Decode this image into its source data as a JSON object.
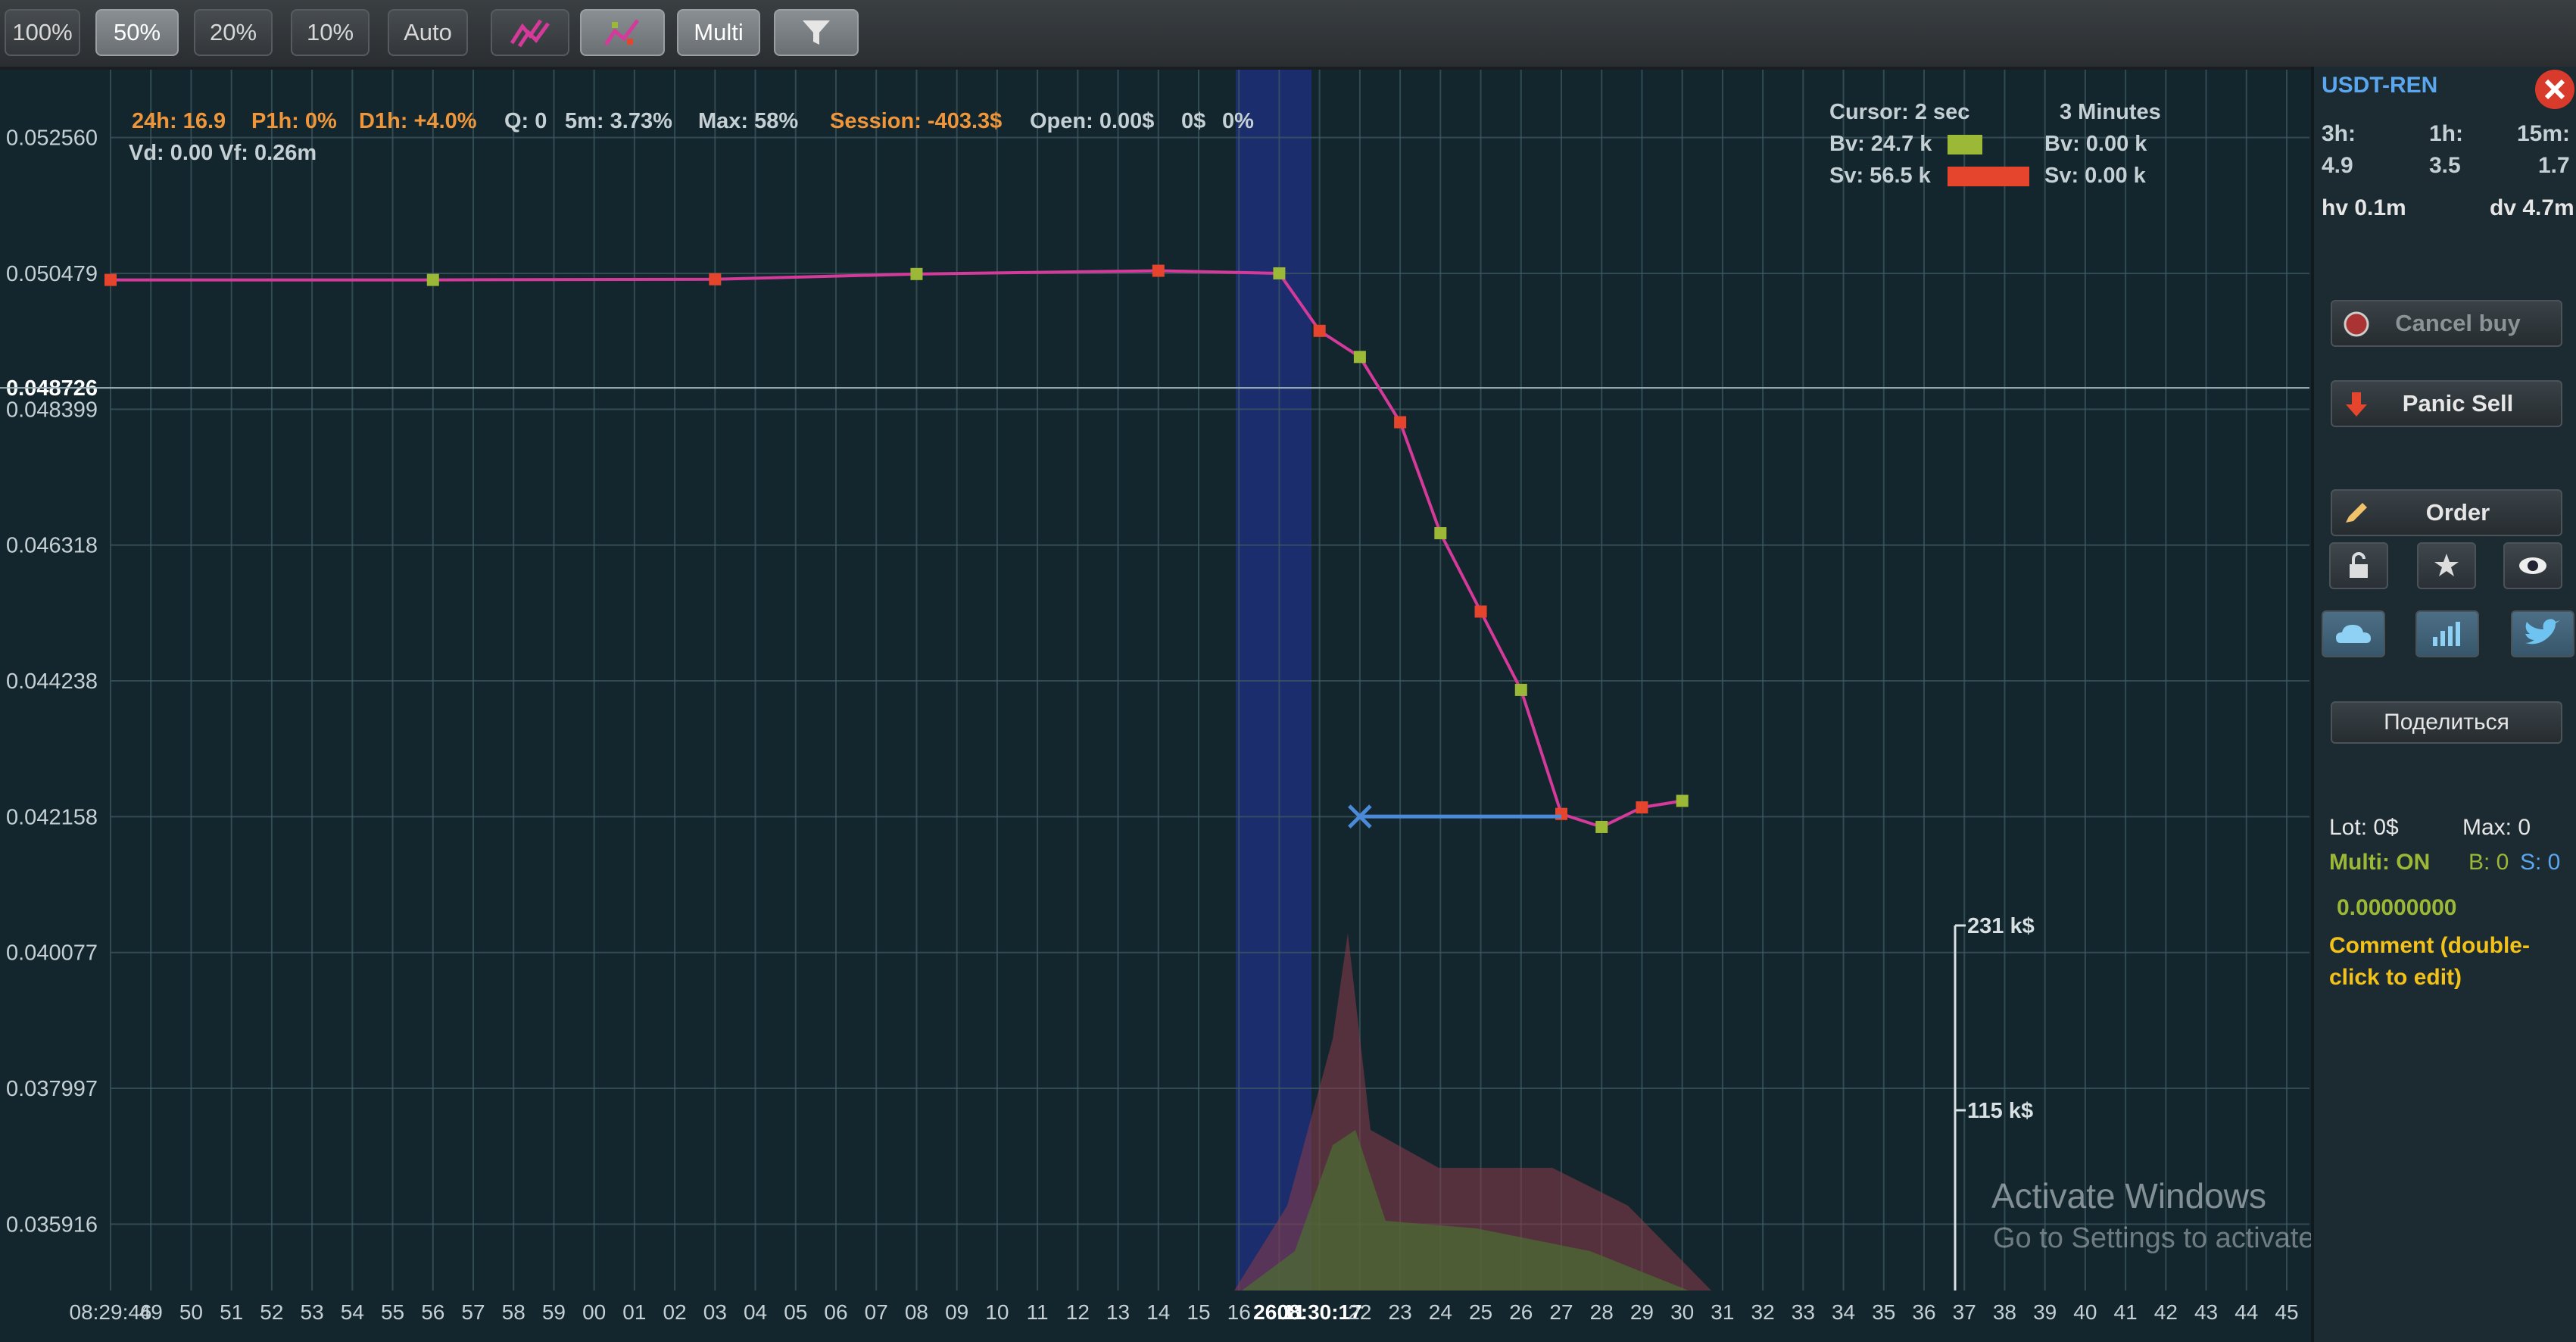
{
  "toolbar": {
    "buttons": [
      "100%",
      "50%",
      "20%",
      "10%",
      "Auto"
    ],
    "active_zoom": "50%",
    "multi_label": "Multi"
  },
  "hud": {
    "stat_24h": "24h: 16.9",
    "stat_p1h": "P1h: 0%",
    "stat_d1h": "D1h: +4.0%",
    "stat_q": "Q: 0",
    "stat_5m": "5m: 3.73%",
    "stat_max": "Max: 58%",
    "session": "Session: -403.3$",
    "open": "Open: 0.00$",
    "open2": "0$",
    "open3": "0%",
    "vd_vf": "Vd: 0.00 Vf: 0.26m",
    "cursor": "Cursor: 2 sec",
    "timeframe": "3 Minutes",
    "bv_left": "Bv: 24.7 k",
    "sv_left": "Sv: 56.5 k",
    "bv_right": "Bv: 0.00 k",
    "sv_right": "Sv: 0.00 k"
  },
  "chart_data": {
    "type": "line",
    "pair": "USDT-REN",
    "y_ticks": [
      "0.052560",
      "0.050479",
      "0.048726",
      "0.048399",
      "0.046318",
      "0.044238",
      "0.042158",
      "0.040077",
      "0.037997",
      "0.035916"
    ],
    "x_ticks": [
      "08:29:46",
      "49",
      "50",
      "51",
      "52",
      "53",
      "54",
      "55",
      "56",
      "57",
      "58",
      "59",
      "00",
      "01",
      "02",
      "03",
      "04",
      "05",
      "06",
      "07",
      "08",
      "09",
      "10",
      "11",
      "12",
      "13",
      "14",
      "15",
      "16",
      "26.11",
      "08:30:17",
      "22",
      "23",
      "24",
      "25",
      "26",
      "27",
      "28",
      "29",
      "30",
      "31",
      "32",
      "33",
      "34",
      "35",
      "36",
      "37",
      "38",
      "39",
      "40",
      "41",
      "42",
      "43",
      "44",
      "45"
    ],
    "ylim": [
      0.0349,
      0.0536
    ],
    "current_price": "0.048726",
    "price_series": [
      {
        "t": 0,
        "p": 0.05038
      },
      {
        "t": 8,
        "p": 0.05038
      },
      {
        "t": 15,
        "p": 0.05039
      },
      {
        "t": 20,
        "p": 0.05047
      },
      {
        "t": 26,
        "p": 0.05052
      },
      {
        "t": 29,
        "p": 0.05048
      },
      {
        "t": 30,
        "p": 0.0496
      },
      {
        "t": 31,
        "p": 0.0492
      },
      {
        "t": 32,
        "p": 0.0482
      },
      {
        "t": 33,
        "p": 0.0465
      },
      {
        "t": 34,
        "p": 0.0453
      },
      {
        "t": 35,
        "p": 0.0441
      },
      {
        "t": 36,
        "p": 0.0422
      },
      {
        "t": 37,
        "p": 0.042
      },
      {
        "t": 38,
        "p": 0.0423
      },
      {
        "t": 39,
        "p": 0.0424
      }
    ],
    "volume_scale": [
      "231 k$",
      "115 k$"
    ],
    "entry_price": 0.04216
  },
  "panel": {
    "pair": "USDT-REN",
    "h3_label": "3h:",
    "h1_label": "1h:",
    "m15_label": "15m:",
    "h3_val": "4.9",
    "h1_val": "3.5",
    "m15_val": "1.7",
    "hv": "hv 0.1m",
    "dv": "dv 4.7m",
    "cancel_buy": "Cancel buy",
    "panic_sell": "Panic Sell",
    "order": "Order",
    "share": "Поделиться",
    "lot": "Lot: 0$",
    "max": "Max: 0",
    "multi": "Multi: ON",
    "b": "B: 0",
    "s": "S: 0",
    "amount": "0.00000000",
    "comment": "Comment (double-click to edit)"
  },
  "watermark": {
    "title": "Activate Windows",
    "subtitle": "Go to Settings to activate Windows."
  },
  "colors": {
    "background": "#14262d",
    "price_line": "#d33a9a",
    "buy": "#9bb836",
    "sell": "#e5452c",
    "highlight": "#1c2f78",
    "entry": "#4a8ad8"
  }
}
